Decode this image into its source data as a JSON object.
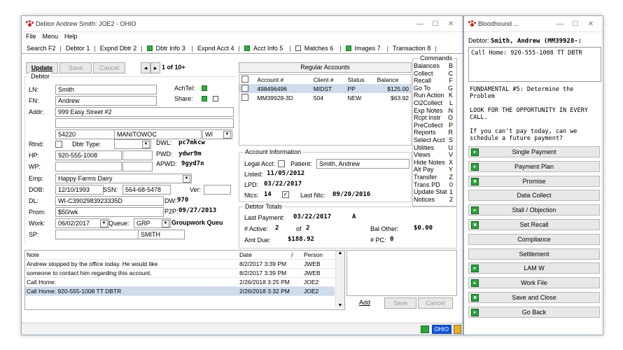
{
  "main": {
    "title": "Debtor Andrew Smith: JOE2 - OHIO",
    "menu": [
      "File",
      "Menu",
      "Help"
    ],
    "tabs": [
      "Search F2",
      "Debtor 1",
      "Expnd Dbtr 2",
      "Dbtr Info 3",
      "Expnd Acct 4",
      "Acct Info 5",
      "Matches 6",
      "Images 7",
      "Transaction 8"
    ],
    "toolbar": {
      "update": "Update",
      "save": "Save",
      "cancel": "Cancel",
      "page": "1 of 10+"
    },
    "debtor_group": "Debtor",
    "fields": {
      "ln_label": "LN:",
      "ln": "Smith",
      "fn_label": "FN:",
      "fn": "Andrew",
      "addr_label": "Addr:",
      "addr1": "999 Easy Street #2",
      "addr2": "",
      "zip": "54220",
      "city": "MANITOWOC",
      "state": "WI",
      "rtnd_label": "Rtnd:",
      "dbtr_type_label": "Dbtr Type:",
      "hp_label": "HP:",
      "hp": "920-555-1008",
      "wp_label": "WP:",
      "wp": "",
      "emp_label": "Emp:",
      "emp": "Happy Farms Dairy",
      "dob_label": "DOB:",
      "dob": "12/10/1993",
      "ssn_label": "SSN:",
      "ssn": "564-68-5478",
      "ver_label": "Ver:",
      "dl_label": "DL:",
      "dl": "WI-C3902983923335D",
      "prom_label": "Prom:",
      "prom": "$50/wk",
      "work_label": "Work:",
      "work": "06/02/2017",
      "queue_label": "Queue:",
      "queue": "GRP",
      "queue_name": "Groupwork Queu",
      "sp_label": "SP:",
      "sp_name": "SMITH",
      "achtel_label": "AchTel:",
      "share_label": "Share:",
      "dwl_label": "DWL:",
      "dwl": "pc7mkcw",
      "pwd_label": "PWD:",
      "pwd": "ydwr9m",
      "apwd_label": "APWD:",
      "apwd": "9gyd7n",
      "dw_label": "DW:",
      "dw": "970",
      "p2p_label": "P2P:",
      "p2p": "09/27/2013"
    },
    "accounts": {
      "header": "Regular Accounts",
      "columns": [
        "Account #",
        "Client #",
        "Status",
        "Balance"
      ],
      "rows": [
        [
          "498496496",
          "MIDST",
          "PP",
          "$125.00"
        ],
        [
          "MM39928-3D",
          "504",
          "NEW",
          "$63.92"
        ]
      ]
    },
    "account_info": {
      "title": "Account Information",
      "legal_acct": "Legal Acct:",
      "patient_label": "Patient:",
      "patient": "Smith, Andrew",
      "listed_label": "Listed:",
      "listed": "11/05/2012",
      "lpd_label": "LPD:",
      "lpd": "03/22/2017",
      "ntcs_label": "Ntcs:",
      "ntcs": "14",
      "last_ntc_label": "Last Ntc:",
      "last_ntc": "09/20/2016"
    },
    "debtor_totals": {
      "title": "Debtor Totals",
      "last_payment_label": "Last Payment:",
      "last_payment": "03/22/2017",
      "last_payment_flag": "A",
      "active_label": "# Active:",
      "active": "2",
      "of_label": "of",
      "of": "2",
      "bal_other_label": "Bal Other:",
      "bal_other": "$0.00",
      "amt_due_label": "Amt Due:",
      "amt_due": "$188.92",
      "pc_label": "# PC:",
      "pc": "0"
    },
    "commands": {
      "title": "Commands",
      "items": [
        [
          "Balances",
          "B"
        ],
        [
          "Collect",
          "C"
        ],
        [
          "Recall",
          "F"
        ],
        [
          "Go To",
          "G"
        ],
        [
          "Run Action",
          "K"
        ],
        [
          "Cl2Collect",
          "L"
        ],
        [
          "Exp Notes",
          "N"
        ],
        [
          "Rcpt Instr",
          "O"
        ],
        [
          "PreCollect",
          "P"
        ],
        [
          "Reports",
          "R"
        ],
        [
          "Select Acct",
          "S"
        ],
        [
          "Utilities",
          "U"
        ],
        [
          "Views",
          "V"
        ],
        [
          "Hide Notes",
          "X"
        ],
        [
          "Alt Pay",
          "Y"
        ],
        [
          "Transfer",
          "Z"
        ],
        [
          "Trans PD",
          "0"
        ],
        [
          "Update Stat",
          "1"
        ],
        [
          "Notices",
          "2"
        ]
      ]
    },
    "notes": {
      "columns": [
        "Note",
        "Date",
        "/",
        "Person"
      ],
      "rows": [
        [
          "Andrew stopped by the office today.  He would like",
          "8/2/2017 3:39 PM",
          "JWEB"
        ],
        [
          " someone to contact him regarding this account.",
          "8/2/2017 3:39 PM",
          "JWEB"
        ],
        [
          "Call Home:",
          "2/26/2018 3:25 PM",
          "JOE2"
        ],
        [
          "Call Home: 920-555-1008 TT DBTR",
          "2/26/2018 3:32 PM",
          "JOE2"
        ]
      ],
      "add": "Add",
      "save": "Save",
      "cancel": "Cancel"
    },
    "status": {
      "state": "OHIO"
    }
  },
  "bloodhound": {
    "title": "Bloodhound ...",
    "debtor_label": "Debtor:",
    "debtor": "Smith, Andrew (MM39928-:",
    "note_text": "Call Home: 920-555-1008 TT DBTR",
    "script": [
      "FUNDAMENTAL #5: Determine the Problem",
      "LOOK FOR THE OPPORTUNITY IN EVERY CALL.",
      "If you can't pay today, can we schedule a future payment?"
    ],
    "buttons": [
      {
        "label": "Single Payment",
        "icon": "play-icon"
      },
      {
        "label": "Payment Plan",
        "icon": "play-icon"
      },
      {
        "label": "Promise",
        "icon": "stop-icon"
      },
      {
        "label": "Data Collect",
        "icon": ""
      },
      {
        "label": "Stall / Objection",
        "icon": "play-icon"
      },
      {
        "label": "Set Recall",
        "icon": "stop-icon"
      },
      {
        "label": "Compliance",
        "icon": ""
      },
      {
        "label": "Settlement",
        "icon": ""
      },
      {
        "label": "LAM W",
        "icon": "play-icon"
      },
      {
        "label": "Work File",
        "icon": "play-icon"
      },
      {
        "label": "Save and Close",
        "icon": "stop-icon"
      },
      {
        "label": "Go Back",
        "icon": "play-icon"
      }
    ]
  }
}
